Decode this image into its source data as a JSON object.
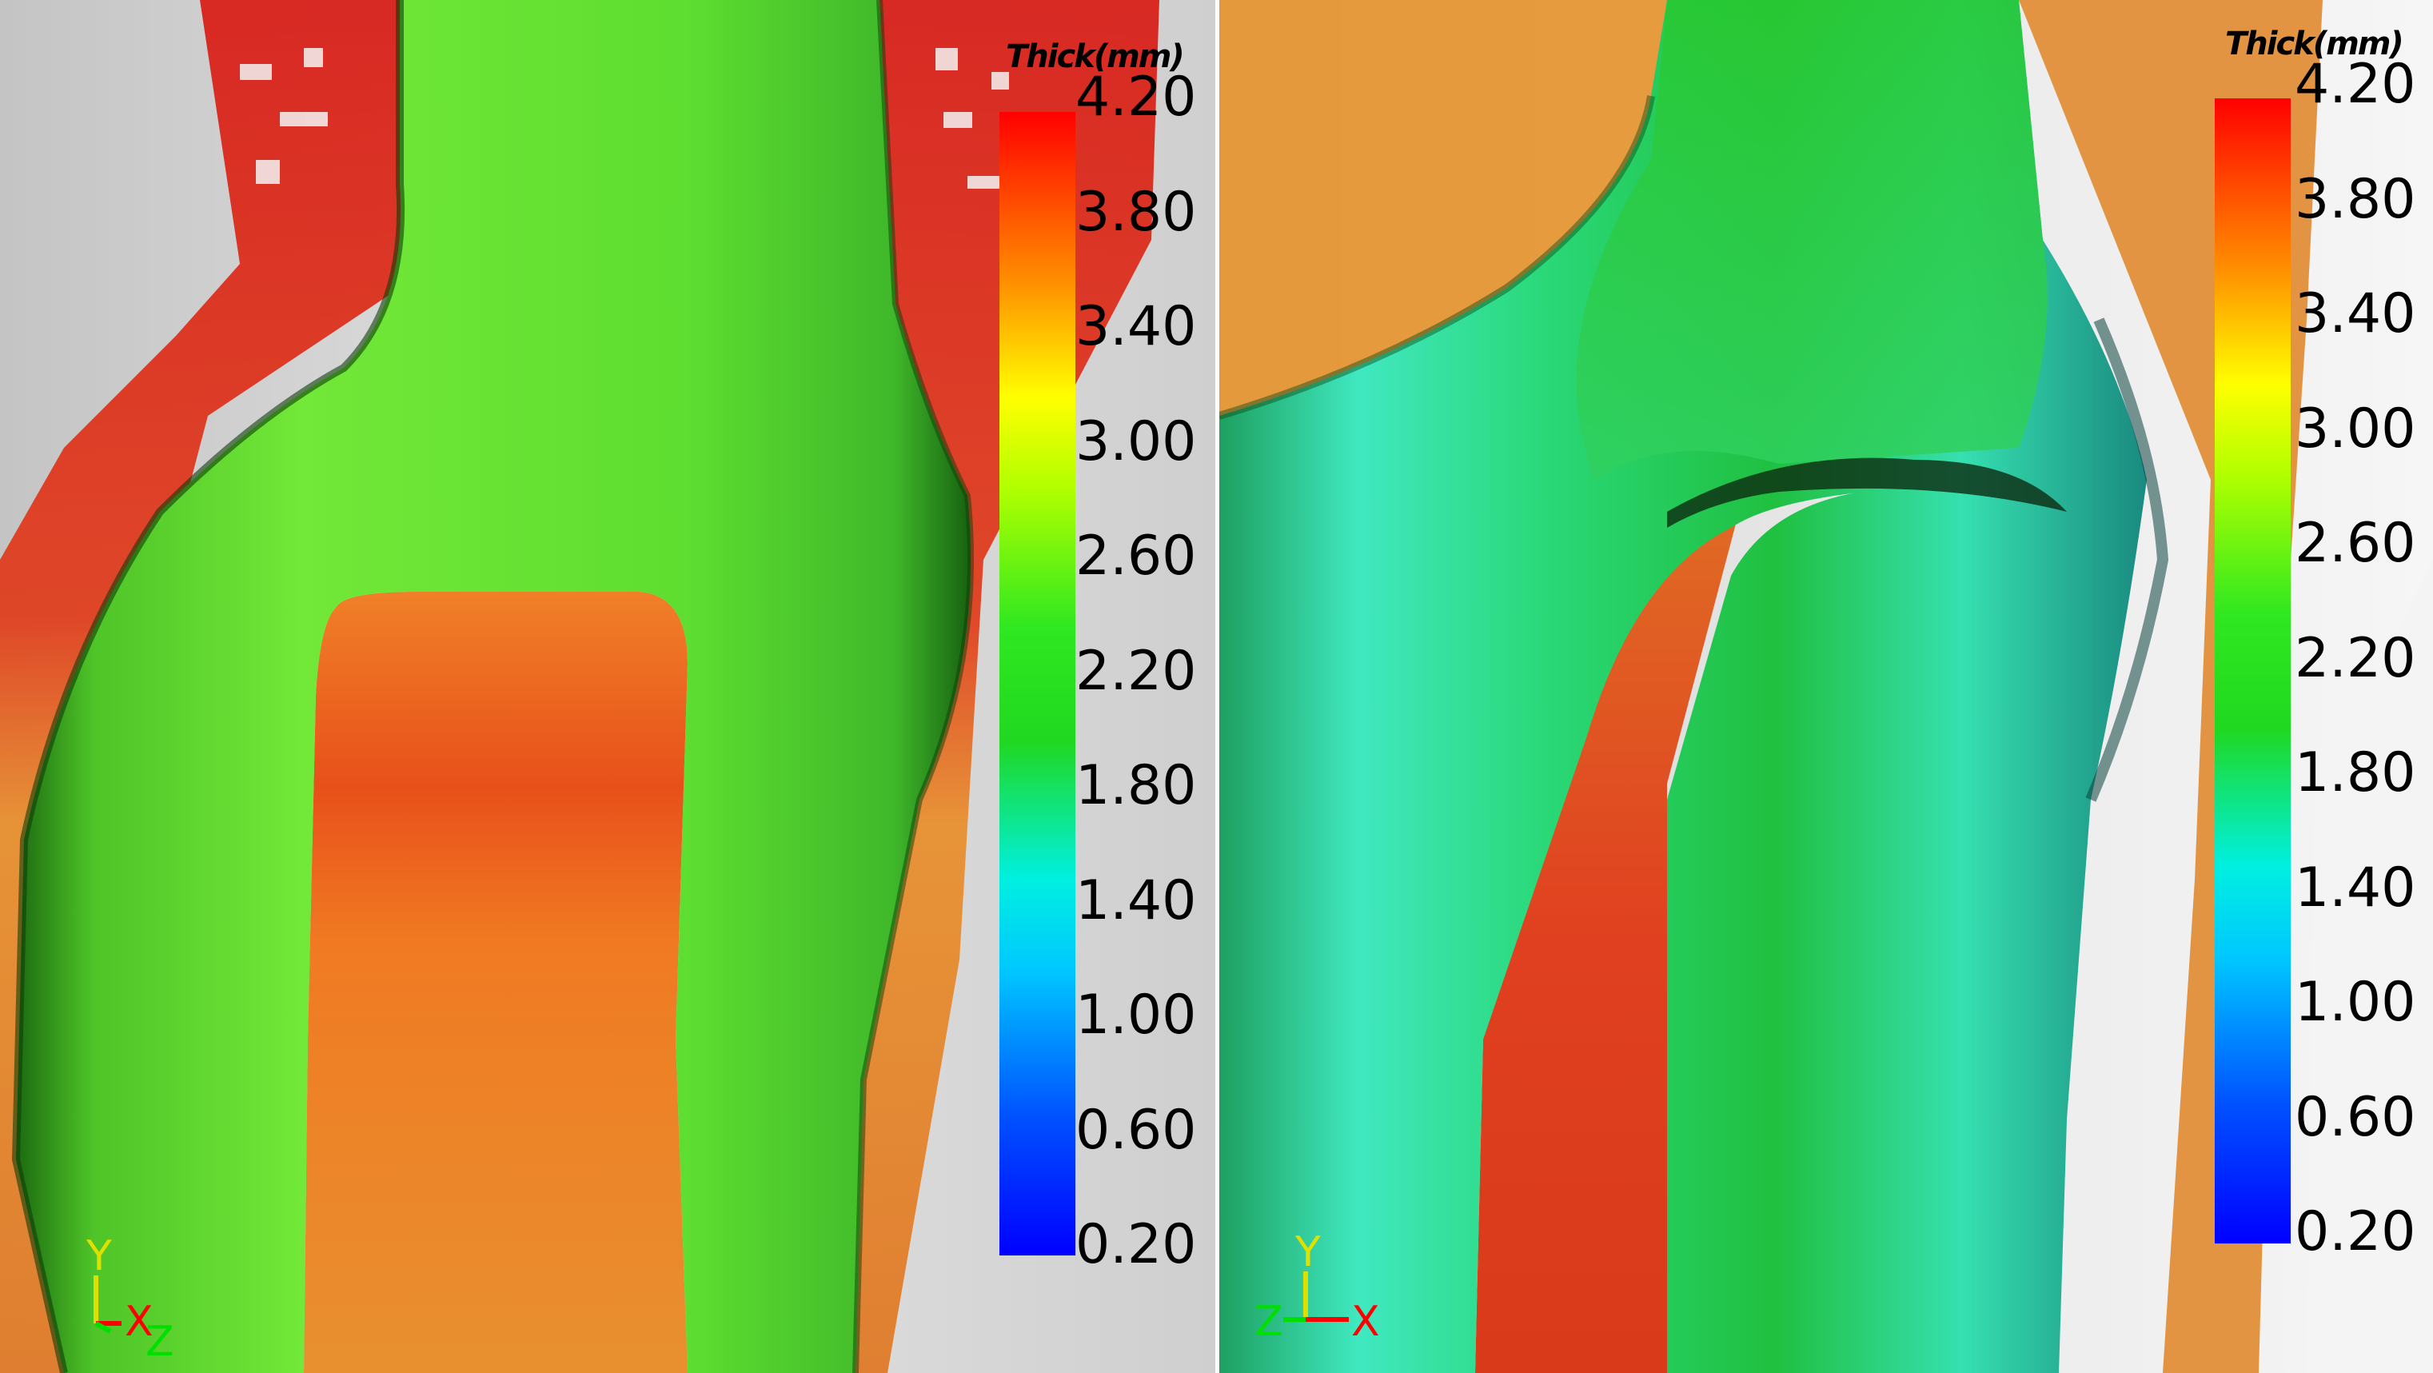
{
  "colorbar": {
    "title": "Thick(mm)",
    "ticks": [
      "4.20",
      "3.80",
      "3.40",
      "3.00",
      "2.60",
      "2.20",
      "1.80",
      "1.40",
      "1.00",
      "0.60",
      "0.20"
    ],
    "min": 0.2,
    "max": 4.2,
    "colormap": [
      "#0000ff",
      "#0078ff",
      "#00f0ff",
      "#00ff80",
      "#1ee01e",
      "#80ff00",
      "#ffff00",
      "#ffa000",
      "#ff3c00",
      "#ff0000"
    ]
  },
  "panels": [
    {
      "axes": {
        "y": "Y",
        "x": "X",
        "z": "Z"
      }
    },
    {
      "axes": {
        "y": "Y",
        "x": "X",
        "z": "Z"
      }
    }
  ],
  "colors": {
    "background": "#d8d8d8",
    "axis_x": "#ff0000",
    "axis_y": "#e0e000",
    "axis_z": "#00e000"
  }
}
